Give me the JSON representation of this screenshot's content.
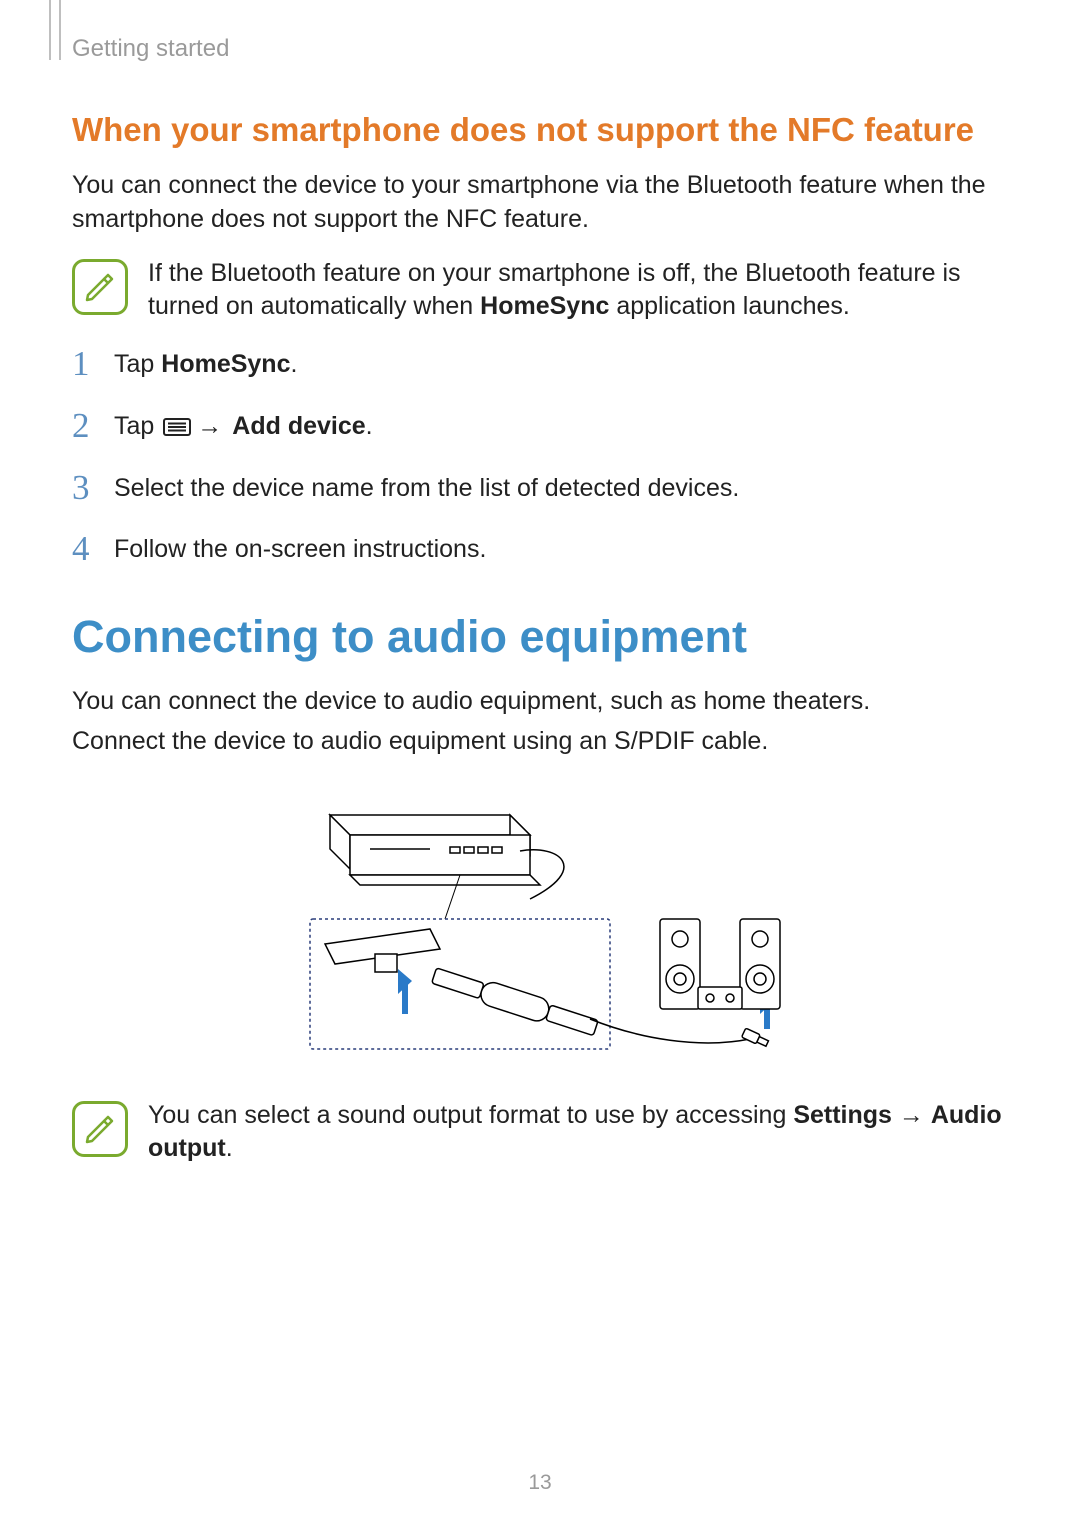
{
  "chapter": "Getting started",
  "sectionA": {
    "heading": "When your smartphone does not support the NFC feature",
    "intro": "You can connect the device to your smartphone via the Bluetooth feature when the smartphone does not support the NFC feature.",
    "note_prefix": "If the Bluetooth feature on your smartphone is off, the Bluetooth feature is turned on automatically when ",
    "note_bold": "HomeSync",
    "note_suffix": " application launches.",
    "steps": {
      "s1_pre": "Tap ",
      "s1_bold": "HomeSync",
      "s1_post": ".",
      "s2_pre": "Tap ",
      "s2_arrow": "→",
      "s2_bold": " Add device",
      "s2_post": ".",
      "s3": "Select the device name from the list of detected devices.",
      "s4": "Follow the on-screen instructions."
    }
  },
  "sectionB": {
    "heading": "Connecting to audio equipment",
    "p1": "You can connect the device to audio equipment, such as home theaters.",
    "p2": "Connect the device to audio equipment using an S/PDIF cable.",
    "note_prefix": "You can select a sound output format to use by accessing ",
    "note_bold1": "Settings",
    "note_arrow": " → ",
    "note_bold2": "Audio output",
    "note_suffix": "."
  },
  "pageNumber": "13"
}
